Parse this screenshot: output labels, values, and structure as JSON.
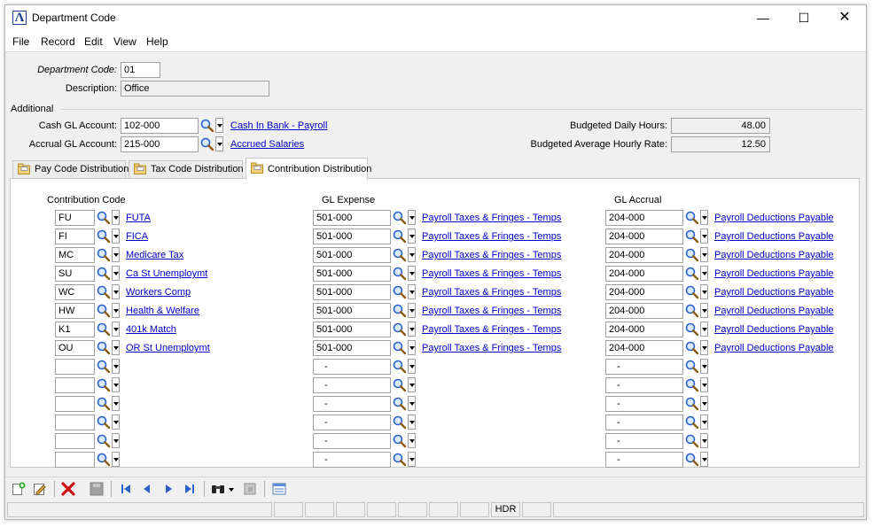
{
  "window": {
    "title": "Department Code"
  },
  "menu": [
    "File",
    "Record",
    "Edit",
    "View",
    "Help"
  ],
  "header": {
    "dept_code_label": "Department Code:",
    "dept_code": "01",
    "description_label": "Description:",
    "description": "Office"
  },
  "additional": {
    "section_label": "Additional",
    "cash_gl_label": "Cash GL Account:",
    "cash_gl": "102-000",
    "cash_gl_desc": "Cash In Bank - Payroll",
    "accrual_gl_label": "Accrual GL Account:",
    "accrual_gl": "215-000",
    "accrual_gl_desc": "Accrued Salaries",
    "daily_hours_label": "Budgeted Daily Hours:",
    "daily_hours": "48.00",
    "avg_rate_label": "Budgeted Average Hourly Rate:",
    "avg_rate": "12.50"
  },
  "tabs": [
    {
      "label": "Pay Code Distribution"
    },
    {
      "label": "Tax Code Distribution"
    },
    {
      "label": "Contribution Distribution"
    }
  ],
  "grid": {
    "headers": {
      "code": "Contribution Code",
      "expense": "GL Expense",
      "accrual": "GL Accrual"
    },
    "rows": [
      {
        "code": "FU",
        "code_desc": "FUTA",
        "expense": "501-000",
        "expense_desc": "Payroll Taxes & Fringes - Temps",
        "accrual": "204-000",
        "accrual_desc": "Payroll Deductions Payable"
      },
      {
        "code": "FI",
        "code_desc": "FICA",
        "expense": "501-000",
        "expense_desc": "Payroll Taxes & Fringes - Temps",
        "accrual": "204-000",
        "accrual_desc": "Payroll Deductions Payable"
      },
      {
        "code": "MC",
        "code_desc": "Medicare Tax",
        "expense": "501-000",
        "expense_desc": "Payroll Taxes & Fringes - Temps",
        "accrual": "204-000",
        "accrual_desc": "Payroll Deductions Payable"
      },
      {
        "code": "SU",
        "code_desc": "Ca St Unemploymt",
        "expense": "501-000",
        "expense_desc": "Payroll Taxes & Fringes - Temps",
        "accrual": "204-000",
        "accrual_desc": "Payroll Deductions Payable"
      },
      {
        "code": "WC",
        "code_desc": "Workers Comp",
        "expense": "501-000",
        "expense_desc": "Payroll Taxes & Fringes - Temps",
        "accrual": "204-000",
        "accrual_desc": "Payroll Deductions Payable"
      },
      {
        "code": "HW",
        "code_desc": "Health & Welfare",
        "expense": "501-000",
        "expense_desc": "Payroll Taxes & Fringes - Temps",
        "accrual": "204-000",
        "accrual_desc": "Payroll Deductions Payable"
      },
      {
        "code": "K1",
        "code_desc": "401k Match",
        "expense": "501-000",
        "expense_desc": "Payroll Taxes & Fringes - Temps",
        "accrual": "204-000",
        "accrual_desc": "Payroll Deductions Payable"
      },
      {
        "code": "OU",
        "code_desc": "OR St Unemploymt",
        "expense": "501-000",
        "expense_desc": "Payroll Taxes & Fringes - Temps",
        "accrual": "204-000",
        "accrual_desc": "Payroll Deductions Payable"
      },
      {
        "code": "",
        "code_desc": "",
        "expense": "-",
        "expense_desc": "",
        "accrual": "-",
        "accrual_desc": ""
      },
      {
        "code": "",
        "code_desc": "",
        "expense": "-",
        "expense_desc": "",
        "accrual": "-",
        "accrual_desc": ""
      },
      {
        "code": "",
        "code_desc": "",
        "expense": "-",
        "expense_desc": "",
        "accrual": "-",
        "accrual_desc": ""
      },
      {
        "code": "",
        "code_desc": "",
        "expense": "-",
        "expense_desc": "",
        "accrual": "-",
        "accrual_desc": ""
      },
      {
        "code": "",
        "code_desc": "",
        "expense": "-",
        "expense_desc": "",
        "accrual": "-",
        "accrual_desc": ""
      },
      {
        "code": "",
        "code_desc": "",
        "expense": "-",
        "expense_desc": "",
        "accrual": "-",
        "accrual_desc": ""
      }
    ]
  },
  "toolbar": [
    {
      "icon": "new-record-icon"
    },
    {
      "icon": "edit-record-icon"
    },
    {
      "icon": "delete-icon"
    },
    {
      "icon": "save-icon"
    },
    {
      "icon": "first-record-icon"
    },
    {
      "icon": "previous-record-icon"
    },
    {
      "icon": "next-record-icon"
    },
    {
      "icon": "last-record-icon"
    },
    {
      "icon": "find-binoculars-icon"
    },
    {
      "icon": "find-options-icon"
    },
    {
      "icon": "copy-icon"
    },
    {
      "icon": "list-view-icon"
    }
  ],
  "status": {
    "mode": "HDR"
  },
  "colors": {
    "link": "#0000c8",
    "accent": "#1f3c8f",
    "delete": "#cc1111"
  }
}
